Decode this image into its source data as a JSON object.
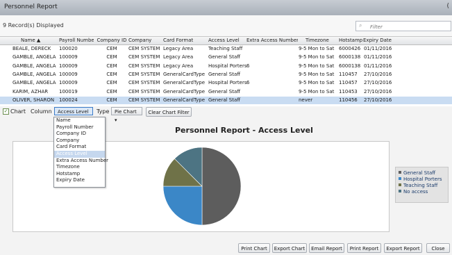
{
  "window": {
    "title": "Personnel Report",
    "close_glyph": "("
  },
  "toolbar": {
    "records_text": "9 Record(s) Displayed",
    "filter_placeholder": "Filter",
    "filter_icon": "search-icon"
  },
  "grid": {
    "columns": [
      "Name ▲",
      "Payroll Number",
      "Company ID",
      "Company",
      "Card Format",
      "Access Level",
      "Extra Access Number",
      "Timezone",
      "Hotstamp",
      "Expiry Date"
    ],
    "rows": [
      [
        "BEALE, DERECK",
        "100020",
        "CEM",
        "CEM SYSTEM",
        "Legacy Area",
        "Teaching Staff",
        "",
        "9-5 Mon to Sat",
        "6000426",
        "01/11/2016"
      ],
      [
        "GAMBLE, ANGELA",
        "100009",
        "CEM",
        "CEM SYSTEM",
        "Legacy Area",
        "General Staff",
        "",
        "9-5 Mon to Sat",
        "6000138",
        "01/11/2016"
      ],
      [
        "GAMBLE, ANGELA",
        "100009",
        "CEM",
        "CEM SYSTEM",
        "Legacy Area",
        "Hospital Porters",
        "6",
        "9-5 Mon to Sat",
        "6000138",
        "01/11/2016"
      ],
      [
        "GAMBLE, ANGELA",
        "100009",
        "CEM",
        "CEM SYSTEM",
        "GeneralCardType",
        "General Staff",
        "",
        "9-5 Mon to Sat",
        "110457",
        "27/10/2016"
      ],
      [
        "GAMBLE, ANGELA",
        "100009",
        "CEM",
        "CEM SYSTEM",
        "GeneralCardType",
        "Hospital Porters",
        "6",
        "9-5 Mon to Sat",
        "110457",
        "27/10/2016"
      ],
      [
        "KARIM, AZHAR",
        "100019",
        "CEM",
        "CEM SYSTEM",
        "GeneralCardType",
        "General Staff",
        "",
        "9-5 Mon to Sat",
        "110453",
        "27/10/2016"
      ],
      [
        "OLIVER, SHARON",
        "100024",
        "CEM",
        "CEM SYSTEM",
        "GeneralCardType",
        "General Staff",
        "",
        "never",
        "110456",
        "27/10/2016"
      ]
    ],
    "selected_row_color": "#c9dcf2"
  },
  "controls": {
    "chart_checkbox_checked": true,
    "chart_label": "Chart",
    "column_label": "Column",
    "column_value": "Access Level",
    "type_label": "Type",
    "type_value": "Pie Chart",
    "clear_filter_label": "Clear Chart Filter",
    "dropdown_caret": "▾"
  },
  "column_dropdown": {
    "options": [
      "Name",
      "Payroll Number",
      "Company ID",
      "Company",
      "Card Format",
      "Access Level",
      "Extra Access Number",
      "Timezone",
      "Hotstamp",
      "Expiry Date"
    ],
    "selected_index": 5
  },
  "chart_data": {
    "type": "pie",
    "title": "Personnel Report - Access Level",
    "categories": [
      "General Staff",
      "Hospital Porters",
      "Teaching Staff",
      "No access"
    ],
    "values": [
      4,
      2,
      1,
      1
    ],
    "colors": [
      "#5d5d5d",
      "#3b87c7",
      "#6f7248",
      "#4d7483"
    ],
    "legend_position": "right"
  },
  "buttons": [
    "Print Chart",
    "Export Chart",
    "Email Report",
    "Print Report",
    "Export Report",
    "Close"
  ]
}
